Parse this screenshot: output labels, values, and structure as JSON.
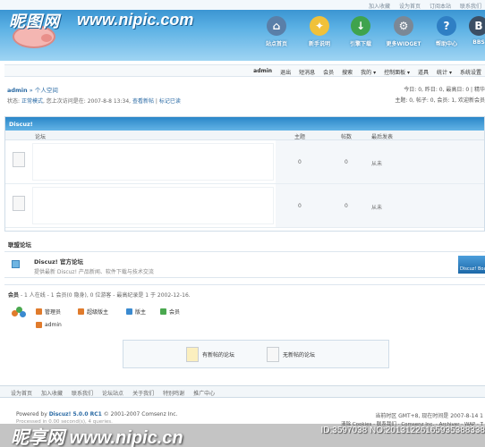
{
  "watermark": {
    "top_logo": "昵图网",
    "top_url": "www.nipic.com",
    "bottom_logo": "昵享网",
    "bottom_url": "www.nipic.cn",
    "bottom_id": "ID:3597038 NO:20131226165935388338"
  },
  "top_links": [
    "加入收藏",
    "设为首页",
    "订阅本站",
    "联系我们"
  ],
  "nav": [
    {
      "label": "站点首页",
      "icon": "house-icon",
      "color": "#5a7fa8"
    },
    {
      "label": "新手说明",
      "icon": "bulb-icon",
      "color": "#f0c13a"
    },
    {
      "label": "引擎下载",
      "icon": "download-icon",
      "color": "#3fa34d"
    },
    {
      "label": "更多WIDGET",
      "icon": "gears-icon",
      "color": "#7b8896"
    },
    {
      "label": "帮助中心",
      "icon": "help-icon",
      "color": "#2f7fc4"
    },
    {
      "label": "BBS",
      "icon": "bbs-icon",
      "color": "#3b4e64"
    }
  ],
  "userbar": [
    "admin",
    "退出",
    "短消息",
    "会员",
    "搜索",
    "我的",
    "控制面板",
    "道具",
    "统计",
    "系统设置"
  ],
  "breadcrumb": {
    "user": "admin",
    "sep": "»",
    "space": "个人空间"
  },
  "status": {
    "prefix": "状态:",
    "mode": "正常模式",
    "last_visit": ", 您上次访问是在: 2007-8-8 13:34,",
    "view_new": "查看新帖",
    "mark_read": "标记已读"
  },
  "stats": {
    "line1": "今日: 0, 昨日: 0, 最高日: 0 | 精华",
    "line2": "主题: 0, 帖子: 0, 会员: 1, 欢迎新会员"
  },
  "forum": {
    "category": "Discuz!",
    "columns": {
      "forum": "论坛",
      "topics": "主题",
      "posts": "帖数",
      "last_post": "最后发表"
    },
    "rows": [
      {
        "topics": "0",
        "posts": "0",
        "last": "从未"
      },
      {
        "topics": "0",
        "posts": "0",
        "last": "从未"
      }
    ]
  },
  "alliance": {
    "title": "联盟论坛",
    "name": "Discuz! 官方论坛",
    "desc": "提供最新 Discuz! 产品新闻、软件下载与技术交流",
    "banner": "Discuz! Board"
  },
  "members": {
    "label": "会员",
    "summary": "- 1 人在线 - 1 会员(0 隐身), 0 位游客 - 最高纪录是 1 于 2002-12-16.",
    "roles": [
      {
        "label": "管理员",
        "color": "#e07b2c"
      },
      {
        "label": "超级版主",
        "color": "#e07b2c"
      },
      {
        "label": "版主",
        "color": "#3a8ad0"
      },
      {
        "label": "会员",
        "color": "#4aa84f"
      }
    ],
    "online_user": "admin"
  },
  "legend": {
    "new": "有新帖的论坛",
    "none": "无新帖的论坛"
  },
  "footer": {
    "links": [
      "设为首页",
      "加入收藏",
      "联系我们",
      "论坛站点",
      "关于我们",
      "特别鸣谢",
      "推广中心"
    ],
    "powered_prefix": "Powered by",
    "powered_brand": "Discuz! 5.0.0 RC1",
    "copyright": "© 2001-2007 Comsenz Inc.",
    "process": "Processed in 0.00 second(s), 4 queries.",
    "time": "当前时区 GMT+8, 现在时间是 2007-8-14 1",
    "links2": "清除 Cookies - 联系我们 - Comsenz Inc. - Archiver - WAP - T"
  }
}
